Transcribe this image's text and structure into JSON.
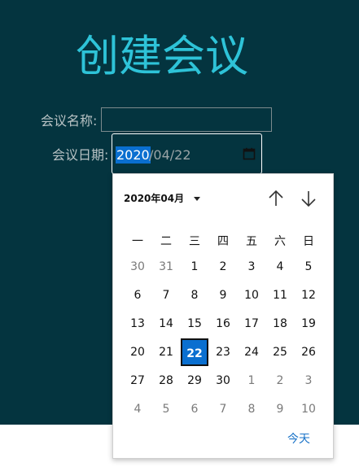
{
  "page": {
    "title": "创建会议",
    "name_label": "会议名称:",
    "date_label": "会议日期:",
    "name_value": ""
  },
  "date_field": {
    "year": "2020",
    "rest": "/04/22"
  },
  "calendar": {
    "month_label": "2020年04月",
    "weekdays": [
      "一",
      "二",
      "三",
      "四",
      "五",
      "六",
      "日"
    ],
    "weeks": [
      [
        {
          "d": "30",
          "o": true
        },
        {
          "d": "31",
          "o": true
        },
        {
          "d": "1"
        },
        {
          "d": "2"
        },
        {
          "d": "3"
        },
        {
          "d": "4"
        },
        {
          "d": "5"
        }
      ],
      [
        {
          "d": "6"
        },
        {
          "d": "7"
        },
        {
          "d": "8"
        },
        {
          "d": "9"
        },
        {
          "d": "10"
        },
        {
          "d": "11"
        },
        {
          "d": "12"
        }
      ],
      [
        {
          "d": "13"
        },
        {
          "d": "14"
        },
        {
          "d": "15"
        },
        {
          "d": "16"
        },
        {
          "d": "17"
        },
        {
          "d": "18"
        },
        {
          "d": "19"
        }
      ],
      [
        {
          "d": "20"
        },
        {
          "d": "21"
        },
        {
          "d": "22",
          "s": true
        },
        {
          "d": "23"
        },
        {
          "d": "24"
        },
        {
          "d": "25"
        },
        {
          "d": "26"
        }
      ],
      [
        {
          "d": "27"
        },
        {
          "d": "28"
        },
        {
          "d": "29"
        },
        {
          "d": "30"
        },
        {
          "d": "1",
          "o": true
        },
        {
          "d": "2",
          "o": true
        },
        {
          "d": "3",
          "o": true
        }
      ],
      [
        {
          "d": "4",
          "o": true
        },
        {
          "d": "5",
          "o": true
        },
        {
          "d": "6",
          "o": true
        },
        {
          "d": "7",
          "o": true
        },
        {
          "d": "8",
          "o": true
        },
        {
          "d": "9",
          "o": true
        },
        {
          "d": "10",
          "o": true
        }
      ]
    ],
    "today_label": "今天"
  },
  "icons": {
    "calendar": "calendar-icon",
    "up": "arrow-up-icon",
    "down": "arrow-down-icon",
    "caret": "chevron-down-icon"
  },
  "colors": {
    "background": "#04343f",
    "title": "#2ec3d8",
    "accent": "#0a6fd0"
  }
}
